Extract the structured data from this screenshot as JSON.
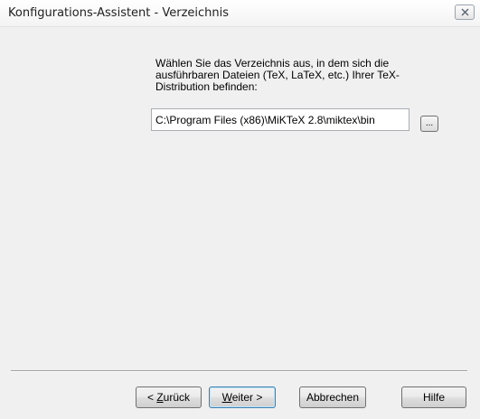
{
  "window": {
    "title": "Konfigurations-Assistent - Verzeichnis"
  },
  "instruction": "Wählen Sie das Verzeichnis aus, in dem sich die ausführbaren Dateien (TeX, LaTeX, etc.) Ihrer TeX-Distribution befinden:",
  "path_input": {
    "value": "C:\\Program Files (x86)\\MiKTeX 2.8\\miktex\\bin"
  },
  "browse_button": {
    "label": "..."
  },
  "buttons": {
    "back": {
      "prefix": "< ",
      "accel": "Z",
      "rest": "urück"
    },
    "next": {
      "accel": "W",
      "rest": "eiter >"
    },
    "cancel": {
      "label": "Abbrechen"
    },
    "help": {
      "label": "Hilfe"
    }
  },
  "icons": {
    "close": "close-icon"
  },
  "colors": {
    "window_bg": "#f0f0f0",
    "default_button_border": "#3c7fb1"
  }
}
